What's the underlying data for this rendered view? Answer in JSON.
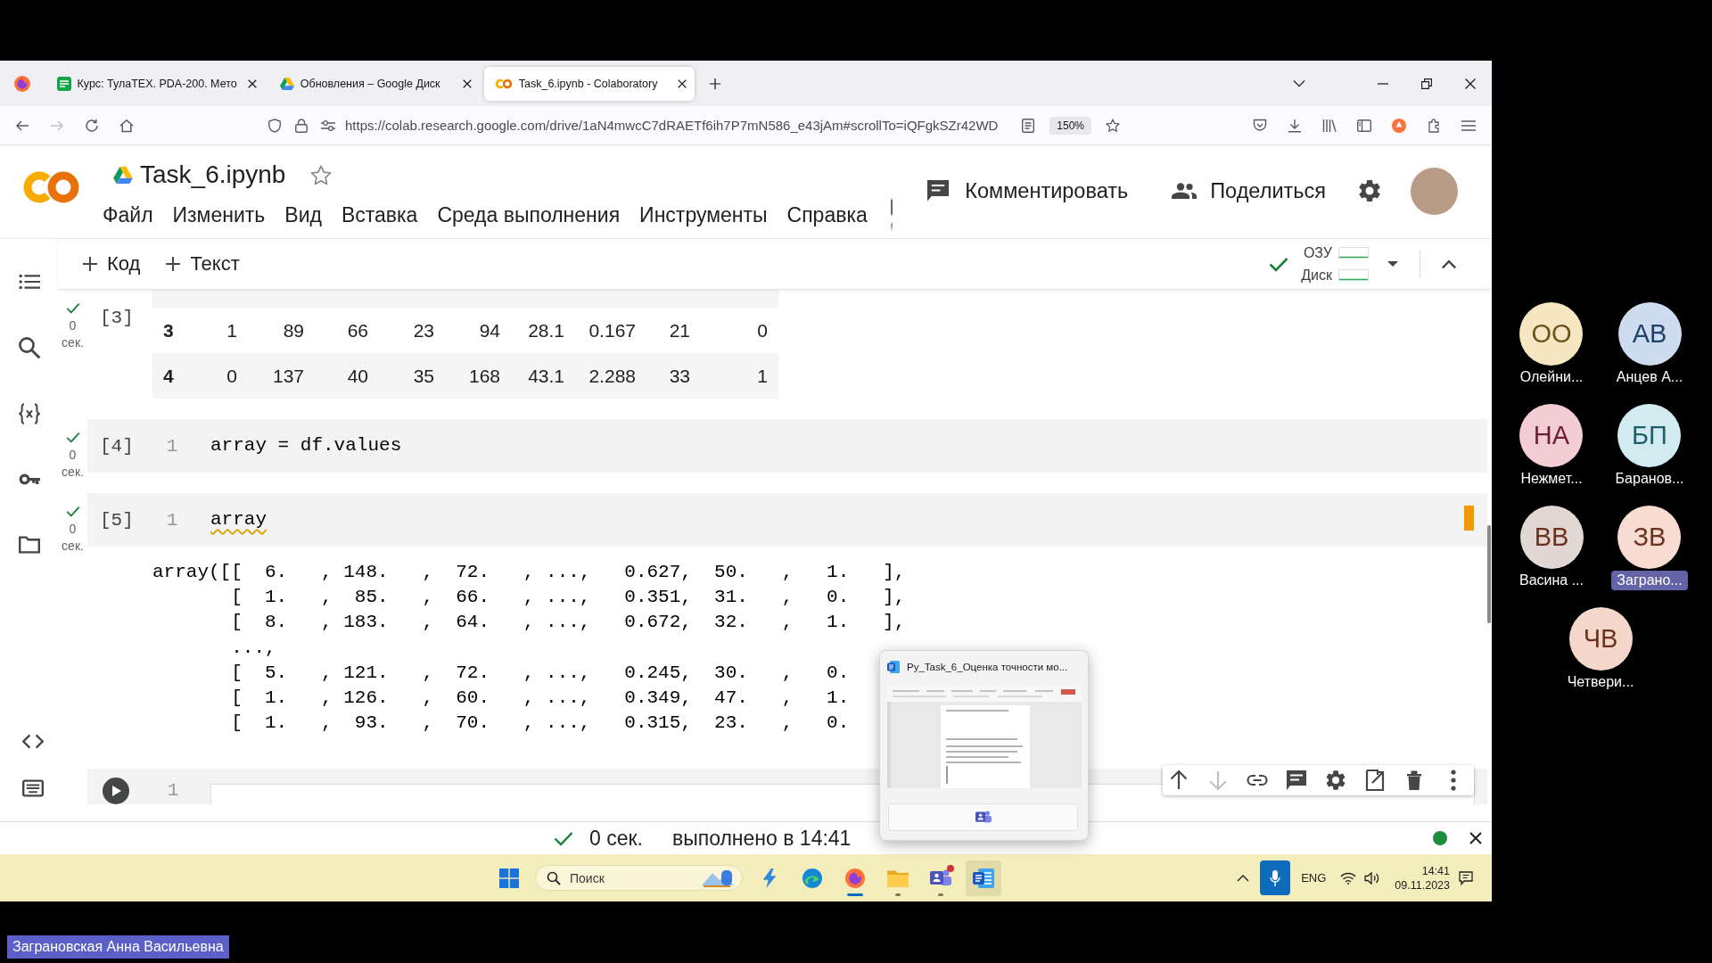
{
  "browser": {
    "tabs": [
      {
        "kind": "course",
        "title": "Курс: ТулаТЕХ. PDA-200. Мето",
        "selected": false
      },
      {
        "kind": "drive",
        "title": "Обновления – Google Диск",
        "selected": false
      },
      {
        "kind": "colab",
        "title": "Task_6.ipynb - Colaboratory",
        "selected": true
      }
    ],
    "forward_disabled": true,
    "url": "https://colab.research.google.com/drive/1aN4mwcC7dRAETf6ih7P7mN586_e43jAm#scrollTo=iQFgkSZr42WD",
    "zoom": "150%"
  },
  "colab": {
    "title": "Task_6.ipynb",
    "menu": [
      "Файл",
      "Изменить",
      "Вид",
      "Вставка",
      "Среда выполнения",
      "Инструменты",
      "Справка"
    ],
    "comment": "Комментировать",
    "share": "Поделиться"
  },
  "toolbar": {
    "add_code": "Код",
    "add_text": "Текст",
    "connected": true,
    "meters": [
      {
        "label": "ОЗУ"
      },
      {
        "label": "Диск"
      }
    ]
  },
  "notebook": {
    "cells": [
      {
        "kind": "table",
        "prompt": "[3]",
        "done": true,
        "time": "0",
        "unit": "сек.",
        "rows": [
          {
            "index": "3",
            "cells": [
              "1",
              "89",
              "66",
              "23",
              "94",
              "28.1",
              "0.167",
              "21",
              "0"
            ]
          },
          {
            "index": "4",
            "cells": [
              "0",
              "137",
              "40",
              "35",
              "168",
              "43.1",
              "2.288",
              "33",
              "1"
            ]
          }
        ]
      },
      {
        "kind": "code",
        "prompt": "[4]",
        "done": true,
        "time": "0",
        "unit": "сек.",
        "marked": false,
        "lines": [
          {
            "number": "1",
            "text": "array = df.values",
            "warning": false
          }
        ]
      },
      {
        "kind": "code",
        "prompt": "[5]",
        "done": true,
        "time": "0",
        "unit": "сек.",
        "marked": true,
        "lines": [
          {
            "number": "1",
            "text": "array",
            "warning": true
          }
        ],
        "output": [
          "array([[  6.   , 148.   ,  72.   , ...,   0.627,  50.   ,   1.   ],",
          "[  1.   ,  85.   ,  66.   , ...,   0.351,  31.   ,   0.   ],",
          "[  8.   , 183.   ,  64.   , ...,   0.672,  32.   ,   1.   ],",
          "...,",
          "[  5.   , 121.   ,  72.   , ...,   0.245,  30.   ,   0.",
          "[  1.   , 126.   ,  60.   , ...,   0.349,  47.   ,   1.",
          "[  1.   ,  93.   ,  70.   , ...,   0.315,  23.   ,   0."
        ]
      },
      {
        "kind": "new",
        "line_number": "1"
      }
    ],
    "cell_toolbar": [
      {
        "kind": "up",
        "disabled": false
      },
      {
        "kind": "down",
        "disabled": true
      },
      {
        "kind": "link",
        "disabled": false
      },
      {
        "kind": "comment",
        "disabled": false
      },
      {
        "kind": "settings",
        "disabled": false
      },
      {
        "kind": "mirror",
        "disabled": false
      },
      {
        "kind": "delete",
        "disabled": false
      },
      {
        "kind": "more",
        "disabled": false
      }
    ]
  },
  "popup": {
    "title": "Py_Task_6_Оценка точности мо..."
  },
  "status_bar": {
    "done": true,
    "duration": "0 сек.",
    "message": "выполнено в 14:41",
    "connected": true
  },
  "taskbar": {
    "search_placeholder": "Поиск",
    "apps": [
      {
        "kind": "bolt",
        "running": false,
        "active": false,
        "hovered": false,
        "badge": false
      },
      {
        "kind": "swirl",
        "running": false,
        "active": false,
        "hovered": false,
        "badge": false
      },
      {
        "kind": "fox",
        "running": true,
        "active": true,
        "hovered": false,
        "badge": false
      },
      {
        "kind": "folder",
        "running": true,
        "active": false,
        "hovered": false,
        "badge": false
      },
      {
        "kind": "chat",
        "running": true,
        "active": false,
        "hovered": false,
        "badge": true
      },
      {
        "kind": "document",
        "running": false,
        "active": false,
        "hovered": true,
        "badge": false
      }
    ],
    "mic_on": true,
    "language": "ENG",
    "time": "14:41",
    "date": "09.11.2023"
  },
  "meeting": {
    "participants": [
      {
        "initials": "ОО",
        "name": "Олейни...",
        "color": "#f6e6c2",
        "highlighted": false
      },
      {
        "initials": "АВ",
        "name": "Анцев А...",
        "color": "#cddcee",
        "highlighted": false
      },
      {
        "initials": "НА",
        "name": "Нежмет...",
        "color": "#f3cdd4",
        "highlighted": false
      },
      {
        "initials": "БП",
        "name": "Баранов...",
        "color": "#d2ebf0",
        "highlighted": false
      },
      {
        "initials": "ВВ",
        "name": "Васина ...",
        "color": "#e3d7d3",
        "highlighted": false
      },
      {
        "initials": "ЗВ",
        "name": "Заграно...",
        "color": "#f8dbd1",
        "highlighted": true
      },
      {
        "initials": "ЧВ",
        "name": "Четвери...",
        "color": "#f5d6cb",
        "highlighted": false
      }
    ],
    "presenter": "Заграновская Анна Васильевна"
  }
}
